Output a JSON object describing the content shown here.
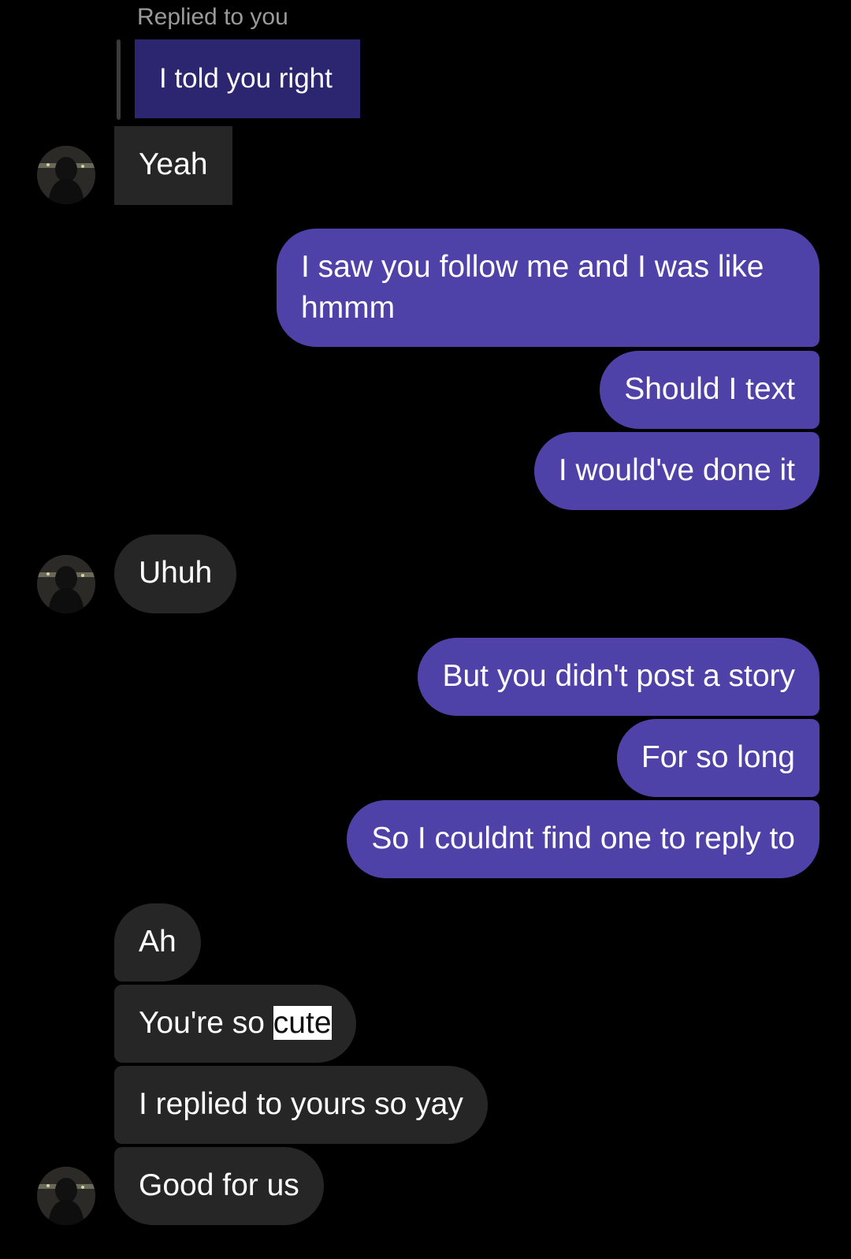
{
  "thread": {
    "reply_label": "Replied to you",
    "quoted_message": "I told you right",
    "messages": [
      {
        "sender": "them",
        "text": "Yeah"
      },
      {
        "sender": "me",
        "text": "I saw you follow me and I was like hmmm"
      },
      {
        "sender": "me",
        "text": "Should I text"
      },
      {
        "sender": "me",
        "text": "I would've done it"
      },
      {
        "sender": "them",
        "text": "Uhuh"
      },
      {
        "sender": "me",
        "text": "But you didn't post a story"
      },
      {
        "sender": "me",
        "text": "For so long"
      },
      {
        "sender": "me",
        "text": "So I couldnt find one to reply to"
      },
      {
        "sender": "them",
        "text": "Ah"
      },
      {
        "sender": "them",
        "text_before": "You're so ",
        "text_highlighted": "cute"
      },
      {
        "sender": "them",
        "text": "I replied to yours so yay"
      },
      {
        "sender": "them",
        "text": "Good for us"
      }
    ]
  },
  "colors": {
    "background": "#000000",
    "incoming_bubble": "#262626",
    "outgoing_bubble": "#4e42a8",
    "quoted_bubble": "#2c2670",
    "reply_label": "#9a9a9a",
    "highlight": "#ffffff"
  },
  "icons": {
    "avatar": "contact-avatar-photo"
  }
}
